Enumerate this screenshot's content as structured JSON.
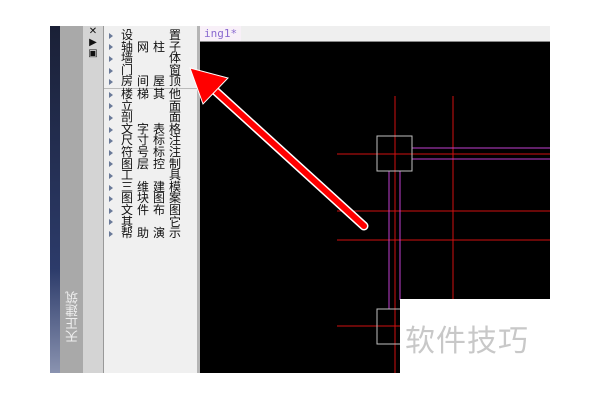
{
  "panel_title": "天正建筑",
  "toolbar_icons": [
    "close-icon",
    "dock-icon",
    "panel-icon"
  ],
  "close_glyph": "✕",
  "menu": [
    "设置",
    "轴网柱子",
    "墙体",
    "门窗",
    "房间屋顶",
    "楼梯其他",
    "立面",
    "剖面",
    "文字表格",
    "尺寸标注",
    "符号标注",
    "图层控制",
    "工具",
    "三维建模",
    "图块图案",
    "文件布图",
    "其它",
    "帮助演示"
  ],
  "drawing_tab": "ing1*",
  "watermark": "软件技巧",
  "colors": {
    "axis": "#d01010",
    "wall": "#c040d0",
    "column": "#c0c0c0",
    "arrow": "#ff0000"
  }
}
